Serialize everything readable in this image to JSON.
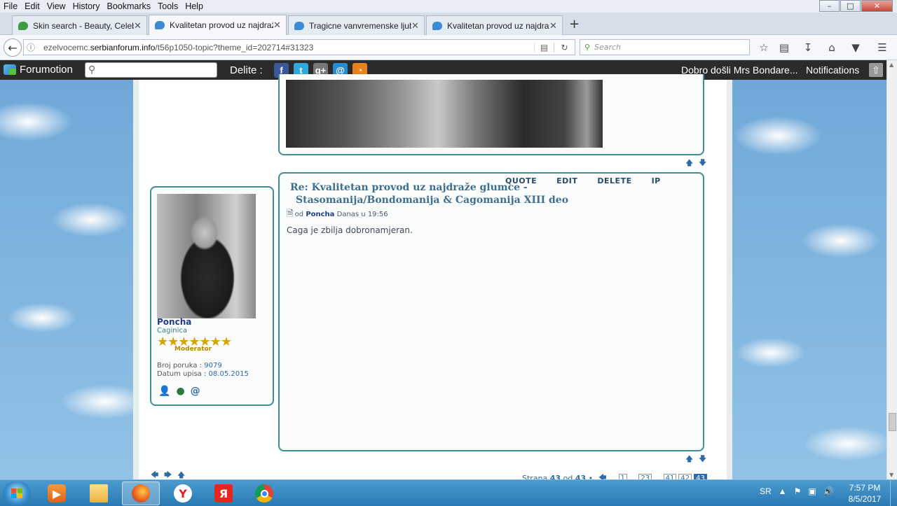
{
  "menu": [
    "File",
    "Edit",
    "View",
    "History",
    "Bookmarks",
    "Tools",
    "Help"
  ],
  "window_controls": {
    "minimize": "–",
    "maximize": "□",
    "close": "✕"
  },
  "tabs": [
    {
      "label": "Skin search - Beauty, Celebrit",
      "icon": "leaf-icon",
      "active": false
    },
    {
      "label": "Kvalitetan provod uz najdraže",
      "icon": "chat-bubble-icon",
      "active": true
    },
    {
      "label": "Tragicne vanvremenske ljuba",
      "icon": "chat-bubble-icon",
      "active": false
    },
    {
      "label": "Kvalitetan provod uz najdraže",
      "icon": "chat-bubble-icon",
      "active": false
    }
  ],
  "tab_close": "✕",
  "new_tab": "+",
  "nav": {
    "url_prefix": "ezelvocemc.",
    "url_domain": "serbianforum.info",
    "url_path": "/t56p1050-topic?theme_id=202714#31323",
    "search_placeholder": "Search"
  },
  "forumotion": {
    "brand": "Forumotion",
    "share_label": "Delite :",
    "social": [
      {
        "name": "facebook",
        "glyph": "f",
        "color": "#3b5998"
      },
      {
        "name": "twitter",
        "glyph": "t",
        "color": "#2fa8e0"
      },
      {
        "name": "google-plus",
        "glyph": "g+",
        "color": "#777777"
      },
      {
        "name": "email",
        "glyph": "@",
        "color": "#2a8ad0"
      },
      {
        "name": "rss",
        "glyph": "◔",
        "color": "#e8801c"
      }
    ],
    "welcome": "Dobro došli Mrs Bondare...",
    "notifications": "Notifications"
  },
  "post": {
    "actions": [
      "QUOTE",
      "EDIT",
      "DELETE",
      "IP"
    ],
    "title": "Re: Kvalitetan provod uz najdraže glumce - Stasomanija/Bondomanija & Cagomanija XIII deo",
    "meta_prefix": "od",
    "author": "Poncha",
    "time": "Danas u 19:56",
    "body": "Caga je zbilja dobronamjeran."
  },
  "profile": {
    "name": "Poncha",
    "rank": "Caginica",
    "stars": 7,
    "stars_text": "★★★★★★★",
    "role": "Moderator",
    "posts_label": "Broj poruka :",
    "posts_value": "9079",
    "joined_label": "Datum upisa :",
    "joined_value": "08.05.2015"
  },
  "pagination": {
    "label_prefix": "Strana",
    "current": "43",
    "of": "od",
    "total": "43",
    "bullet": "•",
    "pages": [
      "1",
      "...",
      "23",
      "...",
      "41",
      "42",
      "43"
    ]
  },
  "taskbar": {
    "language": "SR",
    "time": "7:57 PM",
    "date": "8/5/2017"
  },
  "colors": {
    "accent_border": "#3c8f95",
    "link_blue": "#2d6aa8",
    "title_blue": "#3e6f8f",
    "toolbar_dark": "#2b2b2b",
    "star_gold": "#d9a400"
  }
}
